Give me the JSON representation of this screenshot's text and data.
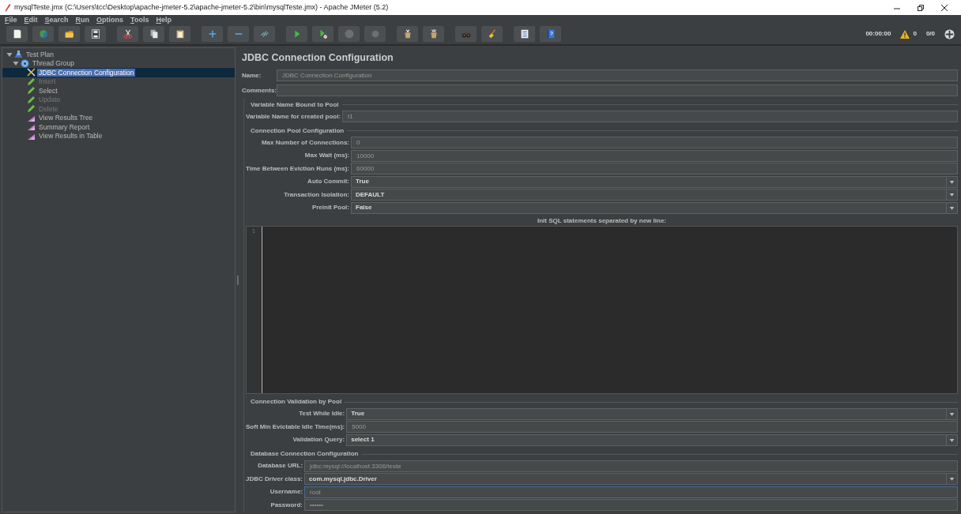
{
  "window": {
    "title": "mysqlTeste.jmx (C:\\Users\\tcc\\Desktop\\apache-jmeter-5.2\\apache-jmeter-5.2\\bin\\mysqlTeste.jmx) - Apache JMeter (5.2)"
  },
  "menu": [
    "File",
    "Edit",
    "Search",
    "Run",
    "Options",
    "Tools",
    "Help"
  ],
  "toolbar_groups": [
    [
      {
        "kind": "new",
        "disabled": false
      },
      {
        "kind": "templates",
        "disabled": false
      },
      {
        "kind": "open",
        "disabled": false
      },
      {
        "kind": "save",
        "disabled": false
      }
    ],
    [
      {
        "kind": "cut",
        "disabled": false
      },
      {
        "kind": "copy",
        "disabled": false
      },
      {
        "kind": "paste",
        "disabled": false
      }
    ],
    [
      {
        "kind": "expand",
        "disabled": false
      },
      {
        "kind": "collapse",
        "disabled": false
      },
      {
        "kind": "toggle",
        "disabled": false
      }
    ],
    [
      {
        "kind": "start",
        "disabled": false
      },
      {
        "kind": "start-no-pause",
        "disabled": false
      },
      {
        "kind": "stop",
        "disabled": true
      },
      {
        "kind": "shutdown",
        "disabled": true
      }
    ],
    [
      {
        "kind": "clear",
        "disabled": false
      },
      {
        "kind": "clear-all",
        "disabled": false
      }
    ],
    [
      {
        "kind": "search",
        "disabled": false
      },
      {
        "kind": "reset-search",
        "disabled": false
      }
    ],
    [
      {
        "kind": "functions",
        "disabled": false
      },
      {
        "kind": "help",
        "disabled": false
      }
    ]
  ],
  "status": {
    "elapsed": "00:00:00",
    "warnings": "0",
    "threads": "0/0"
  },
  "tree": [
    {
      "label": "Test Plan",
      "kind": "plan",
      "expanded": true,
      "selected": false,
      "disabled": false,
      "children": [
        {
          "label": "Thread Group",
          "kind": "thread-group",
          "expanded": true,
          "selected": false,
          "disabled": false,
          "children": [
            {
              "label": "JDBC Connection Configuration",
              "kind": "config",
              "selected": true,
              "disabled": false
            },
            {
              "label": "Insert",
              "kind": "sampler",
              "selected": false,
              "disabled": true
            },
            {
              "label": "Select",
              "kind": "sampler",
              "selected": false,
              "disabled": false
            },
            {
              "label": "Update",
              "kind": "sampler",
              "selected": false,
              "disabled": true
            },
            {
              "label": "Delete",
              "kind": "sampler",
              "selected": false,
              "disabled": true
            },
            {
              "label": "View Results Tree",
              "kind": "listener",
              "selected": false,
              "disabled": false
            },
            {
              "label": "Summary Report",
              "kind": "listener",
              "selected": false,
              "disabled": false
            },
            {
              "label": "View Results in Table",
              "kind": "listener",
              "selected": false,
              "disabled": false
            }
          ]
        }
      ]
    }
  ],
  "panel": {
    "title": "JDBC Connection Configuration",
    "name": {
      "label": "Name:",
      "value": "JDBC Connection Configuration"
    },
    "comments": {
      "label": "Comments:"
    },
    "sections": [
      {
        "title": "Variable Name Bound to Pool",
        "fields": [
          {
            "label": "Variable Name for created pool:",
            "value": "t1",
            "kind": "text",
            "focused": false
          }
        ]
      },
      {
        "title": "Connection Pool Configuration",
        "fields": [
          {
            "label": "Max Number of Connections:",
            "value": "0",
            "kind": "text",
            "focused": false
          },
          {
            "label": "Max Wait (ms):",
            "value": "10000",
            "kind": "text",
            "focused": false
          },
          {
            "label": "Time Between Eviction Runs (ms):",
            "value": "60000",
            "kind": "text",
            "focused": false
          },
          {
            "label": "Auto Commit:",
            "value": "True",
            "kind": "select",
            "focused": false
          },
          {
            "label": "Transaction Isolation:",
            "value": "DEFAULT",
            "kind": "select",
            "focused": false
          },
          {
            "label": "Preinit Pool:",
            "value": "False",
            "kind": "select",
            "focused": false
          }
        ],
        "editor": {
          "label": "Init SQL statements separated by new line:",
          "line_numbers": [
            "1"
          ]
        }
      },
      {
        "title": "Connection Validation by Pool",
        "fields": [
          {
            "label": "Test While Idle:",
            "value": "True",
            "kind": "select",
            "focused": false
          },
          {
            "label": "Soft Min Evictable Idle Time(ms):",
            "value": "5000",
            "kind": "text",
            "focused": false
          },
          {
            "label": "Validation Query:",
            "value": "select 1",
            "kind": "select",
            "focused": false
          }
        ]
      },
      {
        "title": "Database Connection Configuration",
        "fields": [
          {
            "label": "Database URL:",
            "value": "jdbc:mysql://localhost:3306/teste",
            "kind": "text",
            "focused": false
          },
          {
            "label": "JDBC Driver class:",
            "value": "com.mysql.jdbc.Driver",
            "kind": "select",
            "focused": false
          },
          {
            "label": "Username:",
            "value": "root",
            "kind": "text",
            "focused": true
          },
          {
            "label": "Password:",
            "value": "••••••",
            "kind": "text",
            "focused": false
          }
        ]
      }
    ]
  }
}
